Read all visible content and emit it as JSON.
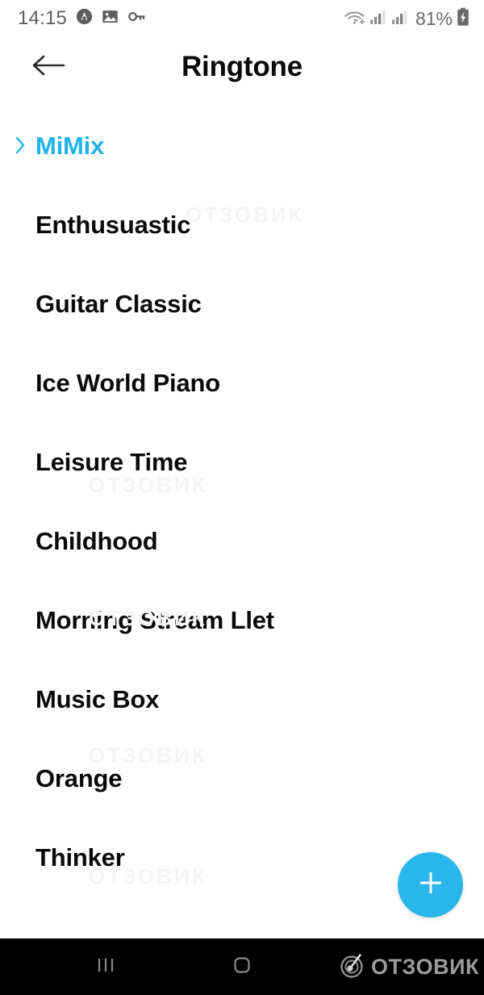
{
  "statusbar": {
    "time": "14:15",
    "battery_percent": "81%",
    "left_icons": [
      {
        "name": "app-notification-icon",
        "glyph": "droplet-in-circle"
      },
      {
        "name": "gallery-image-icon",
        "glyph": "photo"
      },
      {
        "name": "vpn-key-icon",
        "glyph": "key"
      }
    ],
    "right_icons": [
      {
        "name": "wifi-icon",
        "glyph": "wifi"
      },
      {
        "name": "signal-sim1-icon",
        "glyph": "signal-bars"
      },
      {
        "name": "signal-sim2-icon",
        "glyph": "signal-bars"
      },
      {
        "name": "battery-charging-icon",
        "glyph": "battery-bolt"
      }
    ]
  },
  "appbar": {
    "title": "Ringtone",
    "back_icon": "arrow-left-icon"
  },
  "list": {
    "group": {
      "label": "MiMix",
      "chevron_icon": "chevron-right-icon",
      "color": "#1fb3e8"
    },
    "items": [
      {
        "label": "Enthusuastic"
      },
      {
        "label": "Guitar Classic"
      },
      {
        "label": "Ice World Piano"
      },
      {
        "label": "Leisure Time"
      },
      {
        "label": "Childhood"
      },
      {
        "label": "Morning Stream Llet"
      },
      {
        "label": "Music Box"
      },
      {
        "label": "Orange"
      },
      {
        "label": "Thinker"
      }
    ]
  },
  "fab": {
    "icon": "plus-icon",
    "color": "#29b6ea",
    "label": "Add ringtone"
  },
  "navbar": {
    "recents_icon": "recents-icon",
    "home_icon": "home-icon",
    "watermark_text": "ОТЗОВИК",
    "watermark_logo_icon": "otzovik-logo-icon"
  },
  "watermark": {
    "text": "ОТЗОВИК"
  },
  "colors": {
    "accent": "#29b6ea",
    "group_text": "#1fb3e8",
    "text_primary": "#0a0a0a",
    "status_text": "#5d5d5d",
    "navbar_bg": "#000000",
    "background": "#ffffff"
  }
}
